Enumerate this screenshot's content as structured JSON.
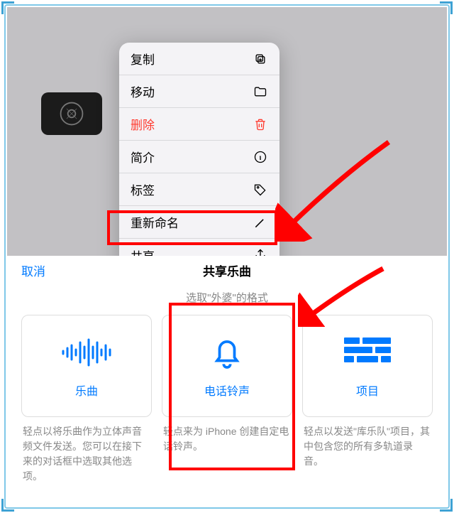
{
  "context_menu": {
    "items": [
      {
        "label": "复制",
        "icon": "copy-icon",
        "destructive": false
      },
      {
        "label": "移动",
        "icon": "folder-icon",
        "destructive": false
      },
      {
        "label": "删除",
        "icon": "trash-icon",
        "destructive": true
      },
      {
        "label": "简介",
        "icon": "info-icon",
        "destructive": false
      },
      {
        "label": "标签",
        "icon": "tag-icon",
        "destructive": false
      },
      {
        "label": "重新命名",
        "icon": "pencil-icon",
        "destructive": false
      },
      {
        "label": "共享",
        "icon": "share-icon",
        "destructive": false
      }
    ]
  },
  "sheet": {
    "cancel": "取消",
    "title": "共享乐曲",
    "subtitle": "选取\"外婆\"的格式",
    "cards": [
      {
        "label": "乐曲",
        "desc": "轻点以将乐曲作为立体声音频文件发送。您可以在接下来的对话框中选取其他选项。"
      },
      {
        "label": "电话铃声",
        "desc": "轻点来为 iPhone 创建自定电话铃声。"
      },
      {
        "label": "项目",
        "desc": "轻点以发送\"库乐队\"项目，其中包含您的所有多轨道录音。"
      }
    ]
  },
  "colors": {
    "accent": "#007aff",
    "destructive": "#ff3b30",
    "highlight": "#ff0000"
  }
}
